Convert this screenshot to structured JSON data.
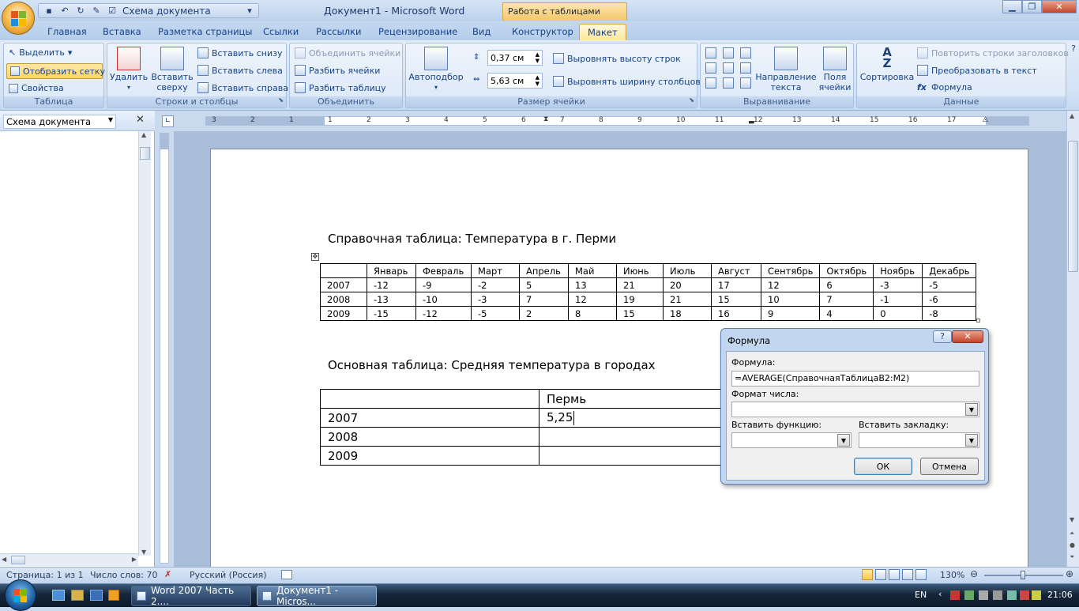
{
  "titlebar": {
    "qat_label": "Схема документа",
    "doc_title": "Документ1 - Microsoft Word",
    "context_tab": "Работа с таблицами"
  },
  "tabs": [
    "Главная",
    "Вставка",
    "Разметка страницы",
    "Ссылки",
    "Рассылки",
    "Рецензирование",
    "Вид",
    "Конструктор",
    "Макет"
  ],
  "ribbon": {
    "table_group": {
      "select": "Выделить",
      "show_grid": "Отобразить сетку",
      "properties": "Свойства",
      "label": "Таблица"
    },
    "rows_cols": {
      "delete": "Удалить",
      "insert_above_1": "Вставить",
      "insert_above_2": "сверху",
      "insert_below": "Вставить снизу",
      "insert_left": "Вставить слева",
      "insert_right": "Вставить справа",
      "label": "Строки и столбцы"
    },
    "merge": {
      "merge_cells": "Объединить ячейки",
      "split_cells": "Разбить ячейки",
      "split_table": "Разбить таблицу",
      "label": "Объединить"
    },
    "cell_size": {
      "autofit": "Автоподбор",
      "height": "0,37 см",
      "width": "5,63 см",
      "dist_rows": "Выровнять высоту строк",
      "dist_cols": "Выровнять ширину столбцов",
      "label": "Размер ячейки"
    },
    "alignment": {
      "direction_1": "Направление",
      "direction_2": "текста",
      "margins_1": "Поля",
      "margins_2": "ячейки",
      "label": "Выравнивание"
    },
    "data": {
      "sort": "Сортировка",
      "repeat_headers": "Повторить строки заголовков",
      "convert": "Преобразовать в текст",
      "formula": "Формула",
      "label": "Данные"
    }
  },
  "docmap": {
    "title": "Схема документа"
  },
  "ruler": {
    "ticks": [
      "3",
      "2",
      "1",
      "1",
      "2",
      "3",
      "4",
      "5",
      "6",
      "7",
      "8",
      "9",
      "10",
      "11",
      "12",
      "13",
      "14",
      "15",
      "16",
      "17"
    ]
  },
  "document": {
    "ref_title": "Справочная таблица: Температура в г. Перми",
    "ref_table": [
      [
        "",
        "Январь",
        "Февраль",
        "Март",
        "Апрель",
        "Май",
        "Июнь",
        "Июль",
        "Август",
        "Сентябрь",
        "Октябрь",
        "Ноябрь",
        "Декабрь"
      ],
      [
        "2007",
        "-12",
        "-9",
        "-2",
        "5",
        "13",
        "21",
        "20",
        "17",
        "12",
        "6",
        "-3",
        "-5"
      ],
      [
        "2008",
        "-13",
        "-10",
        "-3",
        "7",
        "12",
        "19",
        "21",
        "15",
        "10",
        "7",
        "-1",
        "-6"
      ],
      [
        "2009",
        "-15",
        "-12",
        "-5",
        "2",
        "8",
        "15",
        "18",
        "16",
        "9",
        "4",
        "0",
        "-8"
      ]
    ],
    "main_title": "Основная таблица: Средняя температура в городах",
    "main_table": [
      [
        "",
        "Пермь"
      ],
      [
        "2007",
        "5,25"
      ],
      [
        "2008",
        ""
      ],
      [
        "2009",
        ""
      ]
    ]
  },
  "dialog": {
    "title": "Формула",
    "help": "?",
    "formula_label": "Формула:",
    "formula_value": "=AVERAGE(СправочнаяТаблицаB2:M2)",
    "format_label": "Формат числа:",
    "insert_func_label": "Вставить функцию:",
    "insert_bookmark_label": "Вставить закладку:",
    "ok": "ОК",
    "cancel": "Отмена"
  },
  "status": {
    "page": "Страница: 1 из 1",
    "words": "Число слов: 70",
    "lang": "Русский (Россия)",
    "zoom": "130%"
  },
  "taskbar": {
    "task1": "Word 2007 Часть 2....",
    "task2": "Документ1 - Micros...",
    "lang": "EN",
    "time": "21:06"
  },
  "colors": {
    "ribbon_bg": "#dce8f7",
    "accent": "#15428b",
    "tabletools": "#f4c76a"
  }
}
